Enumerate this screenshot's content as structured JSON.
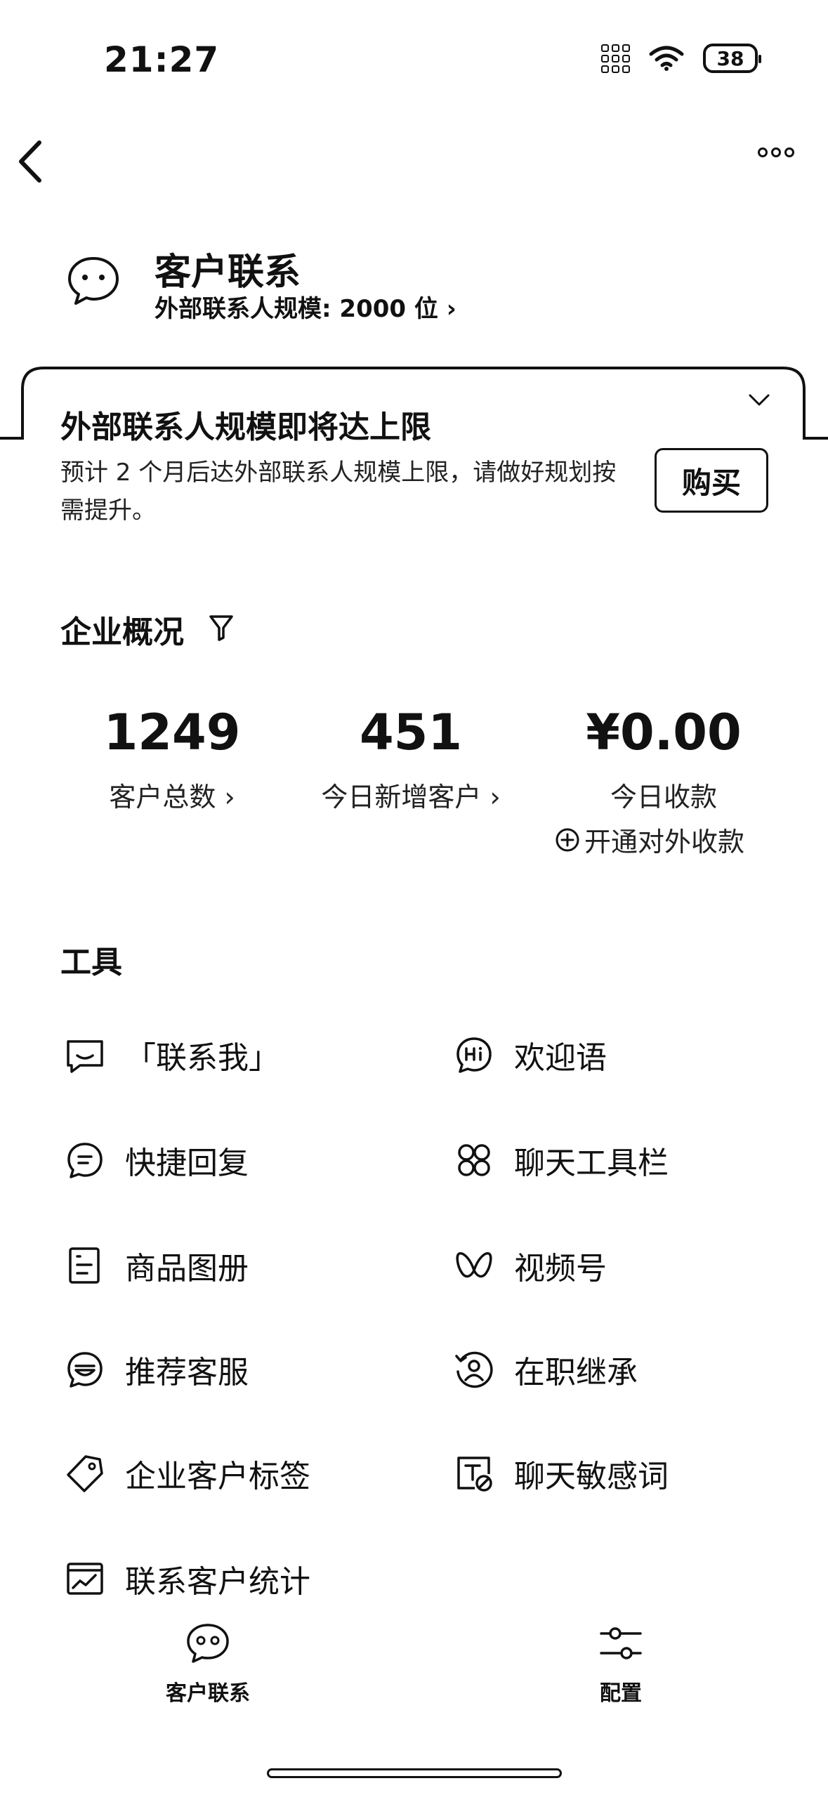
{
  "status_bar": {
    "time": "21:27",
    "battery": "38"
  },
  "header": {
    "title": "客户联系",
    "subtitle": "外部联系人规模: 2000 位 ›"
  },
  "alert": {
    "title": "外部联系人规模即将达上限",
    "text": "预计 2 个月后达外部联系人规模上限，请做好规划按需提升。",
    "button_label": "购买"
  },
  "overview": {
    "title": "企业概况",
    "stats": [
      {
        "value": "1249",
        "label": "客户总数 ›"
      },
      {
        "value": "451",
        "label": "今日新增客户 ›"
      },
      {
        "value": "¥0.00",
        "label": "今日收款"
      }
    ],
    "open_payment": "开通对外收款"
  },
  "tools": {
    "title": "工具",
    "items": [
      {
        "label": "「联系我」",
        "icon": "chat-bubble-icon"
      },
      {
        "label": "欢迎语",
        "icon": "hi-icon"
      },
      {
        "label": "快捷回复",
        "icon": "quick-reply-icon"
      },
      {
        "label": "聊天工具栏",
        "icon": "toolbar-icon"
      },
      {
        "label": "商品图册",
        "icon": "product-catalog-icon"
      },
      {
        "label": "视频号",
        "icon": "channels-icon"
      },
      {
        "label": "推荐客服",
        "icon": "recommend-service-icon"
      },
      {
        "label": "在职继承",
        "icon": "succession-icon"
      },
      {
        "label": "企业客户标签",
        "icon": "tag-icon"
      },
      {
        "label": "聊天敏感词",
        "icon": "sensitive-word-icon"
      },
      {
        "label": "联系客户统计",
        "icon": "stats-icon"
      }
    ]
  },
  "tab_bar": {
    "items": [
      {
        "label": "客户联系",
        "icon": "chat-icon"
      },
      {
        "label": "配置",
        "icon": "settings-sliders-icon"
      }
    ]
  }
}
